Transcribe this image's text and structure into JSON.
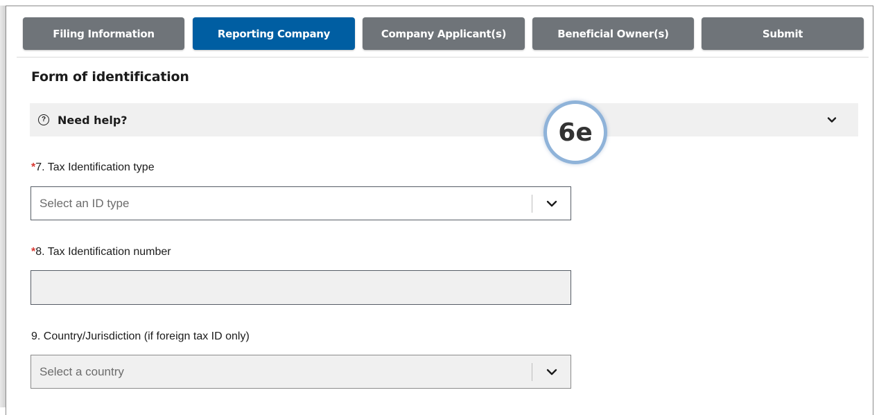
{
  "tabs": [
    {
      "label": "Filing Information",
      "active": false
    },
    {
      "label": "Reporting Company",
      "active": true
    },
    {
      "label": "Company Applicant(s)",
      "active": false
    },
    {
      "label": "Beneficial Owner(s)",
      "active": false
    },
    {
      "label": "Submit",
      "active": false
    }
  ],
  "section": {
    "title": "Form of identification"
  },
  "help": {
    "label": "Need help?",
    "icon": "help-circle-icon",
    "chevron": "chevron-down-icon"
  },
  "badge": {
    "label": "6e"
  },
  "fields": {
    "tax_id_type": {
      "required_mark": "*",
      "label": "7. Tax Identification type",
      "placeholder": "Select an ID type"
    },
    "tax_id_number": {
      "required_mark": "*",
      "label": "8. Tax Identification number",
      "value": ""
    },
    "country": {
      "label": "9. Country/Jurisdiction (if foreign tax ID only)",
      "placeholder": "Select a country"
    }
  },
  "colors": {
    "active_tab": "#005ea2",
    "inactive_tab": "#6f7479",
    "required": "#d83933",
    "badge_ring": "#8fb3d9"
  }
}
